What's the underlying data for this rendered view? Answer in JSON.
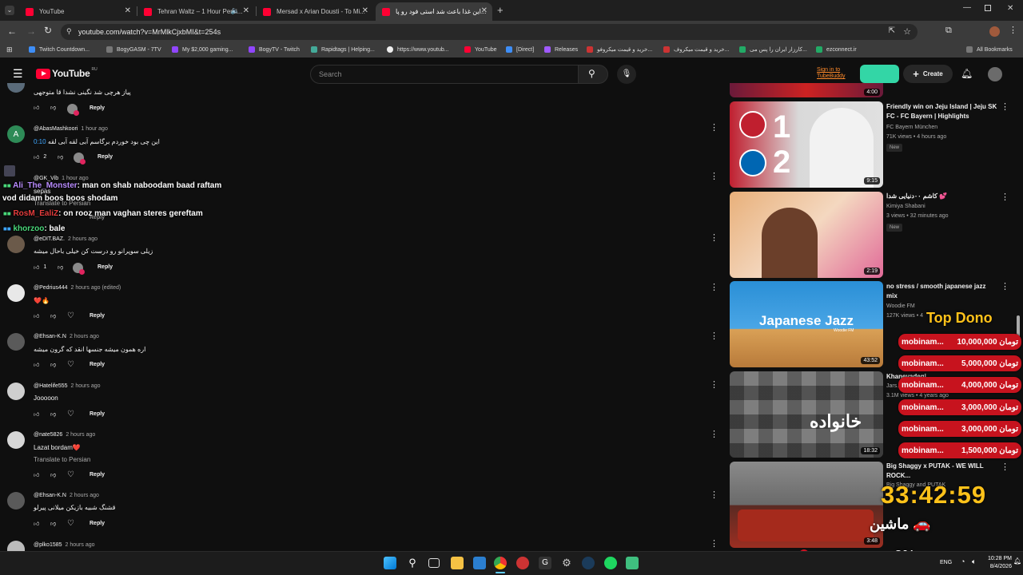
{
  "browser": {
    "tabs": [
      {
        "title": "YouTube"
      },
      {
        "title": "Tehran Waltz – 1 Hour Persi..."
      },
      {
        "title": "Mersad x Arian Dousti - To Mi..."
      },
      {
        "title": "این غذا باعث شد استی فود رو پا..."
      }
    ],
    "url": "youtube.com/watch?v=MrMlkCjxbMI&t=254s",
    "bookmarks": [
      "Twitch Countdown...",
      "BogyGASM - 7TV",
      "My $2,000 gaming...",
      "BogyTV - Twitch",
      "Rapidtags | Helping...",
      "https://www.youtub...",
      "YouTube",
      "[Direct]",
      "Releases",
      "خرید و قیمت میکروفو...",
      "خرید و قیمت میکروف...",
      "کارزار ایران را پس می...",
      "ezconnect.ir"
    ],
    "all_bookmarks": "All Bookmarks"
  },
  "youtube": {
    "logo": "YouTube",
    "region": "RU",
    "search_placeholder": "Search",
    "tubebuddy": "Sign in to TubeBuddy",
    "create": "Create"
  },
  "comments": [
    {
      "name": "",
      "time": "",
      "text": "پیاز هرچی شد نگینی نشدا قا متوجهی",
      "likes": ""
    },
    {
      "name": "@AbasMashkoori",
      "time": "1 hour ago",
      "link": "0:10",
      "text": "این چی بود خوردم برگاسم آبی لقه آبی لقه",
      "likes": "2",
      "avatar_letter": "A"
    },
    {
      "name": "@GK_Vib",
      "time": "1 hour ago",
      "text": "sepas",
      "translate": "Translate to Persian"
    },
    {
      "name": "@eDIT.BAZ.",
      "time": "2 hours ago",
      "text": "زیلی سوپرانو رو درست کن خیلی باحال میشه",
      "likes": "1"
    },
    {
      "name": "@Pedrius444",
      "time": "2 hours ago (edited)",
      "text": "❤️🔥"
    },
    {
      "name": "@Ehsan-K.N",
      "time": "2 hours ago",
      "text": "اره همون میشه جنسها انقد که گرون میشه"
    },
    {
      "name": "@Hatelife555",
      "time": "2 hours ago",
      "text": "Jooooon"
    },
    {
      "name": "@nate5826",
      "time": "2 hours ago",
      "text": "Lazat bordam❤️",
      "translate": "Translate to Persian"
    },
    {
      "name": "@Ehsan-K.N",
      "time": "2 hours ago",
      "text": "قشنگ شبیه بازیکن میلانی پیرلو"
    },
    {
      "name": "@plko1585",
      "time": "2 hours ago"
    }
  ],
  "reply_label": "Reply",
  "chat": [
    {
      "user": "Ali_The_Monster",
      "msg": ": man on shab naboodam baad raftam"
    },
    {
      "user": "",
      "msg": "vod didam boos boos shodam"
    },
    {
      "user": "RosM_EaliZ",
      "msg": ": on rooz man vaghan steres gereftam"
    },
    {
      "user": "khorzoo",
      "msg": ": bale"
    }
  ],
  "sidebar": [
    {
      "duration": "4:00"
    },
    {
      "title": "Friendly win on Jeju Island | Jeju SK FC - FC Bayern | Highlights",
      "channel": "FC Bayern München",
      "meta": "71K views • 4 hours ago",
      "badge": "New",
      "duration": "9:15"
    },
    {
      "title": "کاشم ۰۰دنیایی شدا 💕",
      "channel": "Kimiya Shabani",
      "meta": "3 views • 32 minutes ago",
      "badge": "New",
      "duration": "2:19"
    },
    {
      "title": "no stress / smooth japanese jazz mix",
      "channel": "Woodie FM",
      "meta": "127K views • 4",
      "thumb_text": "Japanese Jazz",
      "thumb_sub": "Woodie FM",
      "duration": "43:52"
    },
    {
      "title": "Khanevadegi...",
      "channel": "Jars...",
      "meta": "3.1M views • 4 years ago",
      "duration": "18:32"
    },
    {
      "title": "Big Shaggy x PUTAK - WE WILL ROCK...",
      "channel": "Big Shaggy and PUTAK",
      "meta": "",
      "duration": "3:48"
    }
  ],
  "overlay": {
    "top_dono_title": "Top Dono",
    "donations": [
      {
        "name": "mobinam...",
        "amount": "10,000,000",
        "currency": "تومان"
      },
      {
        "name": "mobinam...",
        "amount": "5,000,000",
        "currency": "تومان"
      },
      {
        "name": "mobinam...",
        "amount": "4,000,000",
        "currency": "تومان"
      },
      {
        "name": "mobinam...",
        "amount": "3,000,000",
        "currency": "تومان"
      },
      {
        "name": "mobinam...",
        "amount": "3,000,000",
        "currency": "تومان"
      },
      {
        "name": "mobinam...",
        "amount": "1,500,000",
        "currency": "تومان"
      }
    ],
    "timer": "33:42:59",
    "goal_label": "ماشین 🚗",
    "percent": "3%"
  },
  "taskbar": {
    "lang": "ENG",
    "time": "10:28 PM",
    "date": "8/4/2026"
  }
}
